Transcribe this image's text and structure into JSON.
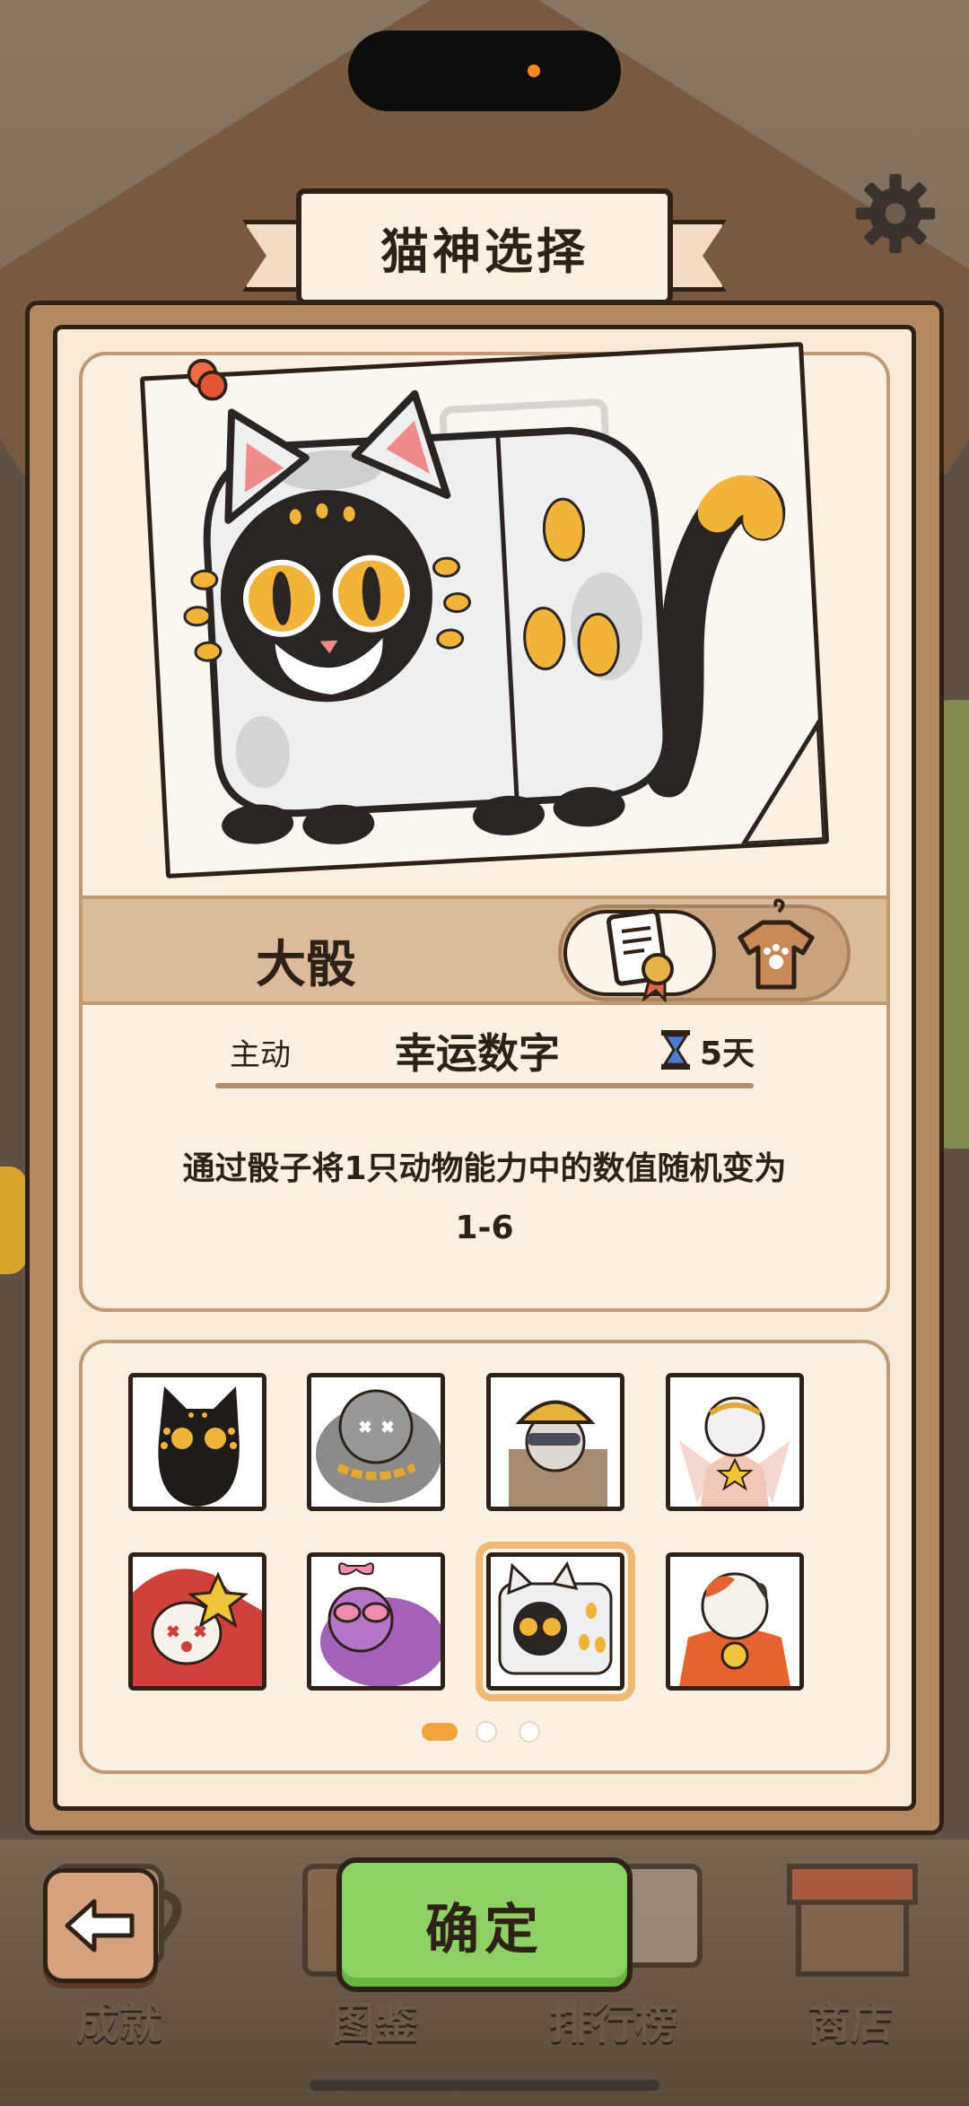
{
  "title": "猫神选择",
  "selected": {
    "name": "大骰",
    "skill_type": "主动",
    "skill_name": "幸运数字",
    "duration": "5天",
    "description": "通过骰子将1只动物能力中的数值随机变为1-6"
  },
  "tabs": [
    "certificate-icon",
    "outfit-icon"
  ],
  "cats": [
    {
      "icon": "black-cat-portrait",
      "selected": false
    },
    {
      "icon": "gray-chain-cat-portrait",
      "selected": false
    },
    {
      "icon": "miner-helmet-cat-portrait",
      "selected": false
    },
    {
      "icon": "star-angel-cat-portrait",
      "selected": false
    },
    {
      "icon": "clown-cat-portrait",
      "selected": false
    },
    {
      "icon": "purple-sunglasses-cat-portrait",
      "selected": false
    },
    {
      "icon": "dice-cat-portrait",
      "selected": true
    },
    {
      "icon": "lucky-calico-cat-portrait",
      "selected": false
    }
  ],
  "pagination": {
    "current": 1,
    "total": 3
  },
  "buttons": {
    "confirm": "确定"
  },
  "bottom_nav": [
    "成就",
    "图鉴",
    "排行榜",
    "商店"
  ],
  "colors": {
    "accent": "#8ed064",
    "panel": "#f7ead7",
    "frame": "#b58a62",
    "selection": "#f2b875"
  }
}
